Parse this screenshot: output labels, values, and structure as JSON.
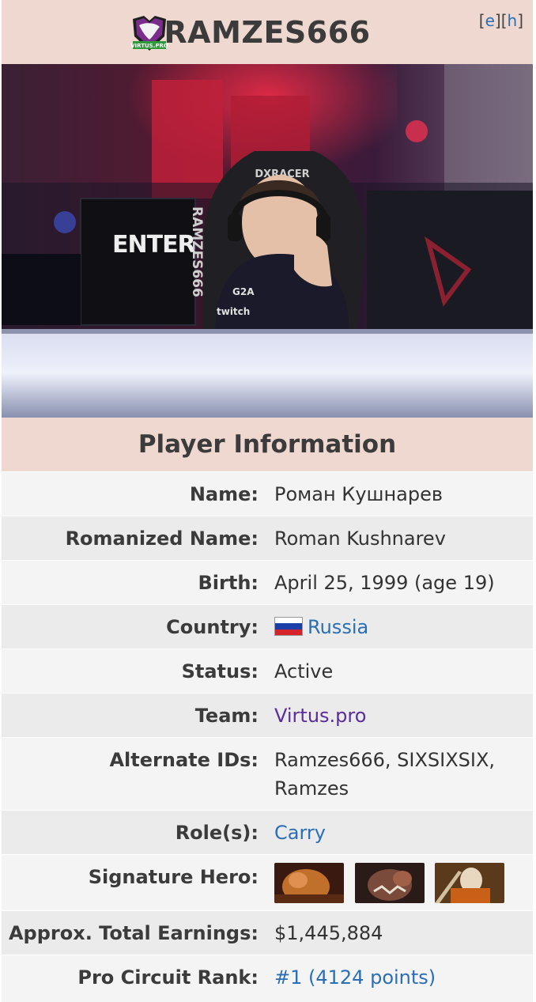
{
  "header": {
    "player_name": "RAMZES666",
    "edit_links": {
      "open": "[",
      "e": "e",
      "middle": "][",
      "h": "h",
      "close": "]"
    },
    "team_logo_icon": "virtus-pro-logo"
  },
  "photo": {
    "icon": "player-photo",
    "monitor_text": "ENTER",
    "monitor_side_text": "RAMZES666",
    "chair_text": "DXRACER",
    "jersey_sponsors": [
      "G2A",
      "twitch"
    ]
  },
  "section_title": "Player Information",
  "info": {
    "name_label": "Name:",
    "name_value": "Роман Кушнарев",
    "romanized_label": "Romanized Name:",
    "romanized_value": "Roman Kushnarev",
    "birth_label": "Birth:",
    "birth_value": "April 25, 1999 (age 19)",
    "country_label": "Country:",
    "country_value": "Russia",
    "country_flag_colors": [
      "#ffffff",
      "#1c3ea8",
      "#d5222b"
    ],
    "status_label": "Status:",
    "status_value": "Active",
    "team_label": "Team:",
    "team_value": "Virtus.pro",
    "alt_ids_label": "Alternate IDs:",
    "alt_ids_value_line1": "Ramzes666, SIXSIXSIX,",
    "alt_ids_value_line2": "Ramzes",
    "roles_label": "Role(s):",
    "roles_value": "Carry",
    "signature_label": "Signature Hero:",
    "signature_heroes": [
      "hero-portrait-1",
      "hero-portrait-2",
      "hero-portrait-3"
    ],
    "earnings_label": "Approx. Total Earnings:",
    "earnings_value": "$1,445,884",
    "rank_label": "Pro Circuit Rank:",
    "rank_value": "#1 (4124 points)"
  },
  "colors": {
    "header_bg": "#efd8d0",
    "link": "#2a6fb5",
    "team_link": "#5a2d9a"
  }
}
